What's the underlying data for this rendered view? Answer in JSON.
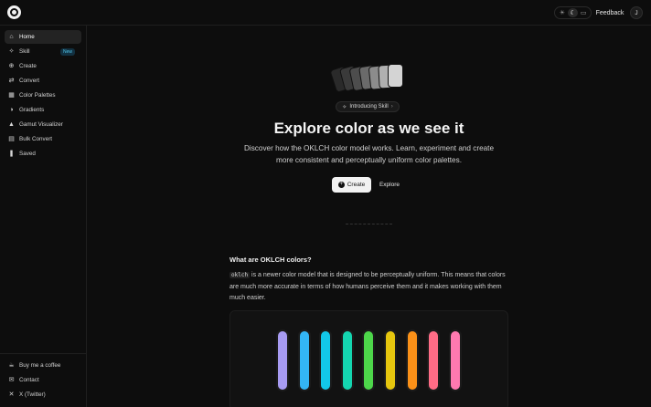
{
  "topbar": {
    "feedback_label": "Feedback",
    "avatar_initial": "J",
    "theme_options": [
      "☀",
      "☾",
      "▭"
    ]
  },
  "sidebar": {
    "items": [
      {
        "label": "Home",
        "icon": "home-icon",
        "glyph": "⌂"
      },
      {
        "label": "Skill",
        "icon": "sparkles-icon",
        "glyph": "✧",
        "badge": "New"
      },
      {
        "label": "Create",
        "icon": "plus-circle-icon",
        "glyph": "⊕"
      },
      {
        "label": "Convert",
        "icon": "swap-icon",
        "glyph": "⇄"
      },
      {
        "label": "Color Palettes",
        "icon": "palette-icon",
        "glyph": "▦"
      },
      {
        "label": "Gradients",
        "icon": "gradient-icon",
        "glyph": "◑"
      },
      {
        "label": "Gamut Visualizer",
        "icon": "gamut-icon",
        "glyph": "▲"
      },
      {
        "label": "Bulk Convert",
        "icon": "bulk-icon",
        "glyph": "▤"
      },
      {
        "label": "Saved",
        "icon": "bookmark-icon",
        "glyph": "❚"
      }
    ],
    "footer": [
      {
        "label": "Buy me a coffee",
        "icon": "coffee-icon",
        "glyph": "☕"
      },
      {
        "label": "Contact",
        "icon": "mail-icon",
        "glyph": "✉"
      },
      {
        "label": "X (Twitter)",
        "icon": "x-icon",
        "glyph": "✕"
      }
    ]
  },
  "hero": {
    "pill_label": "Introducing Skill",
    "title": "Explore color as we see it",
    "subtitle": "Discover how the OKLCH color model works. Learn, experiment and create more consistent and perceptually uniform color palettes.",
    "create_label": "Create",
    "explore_label": "Explore",
    "swatch_colors": [
      "#2a2a2a",
      "#3a3a3a",
      "#4d4d4d",
      "#6a6a6a",
      "#8c8c8c",
      "#b0b0b0",
      "#d4d4d4"
    ]
  },
  "section": {
    "title": "What are OKLCH colors?",
    "code_word": "oklch",
    "body": " is a newer color model that is designed to be perceptually uniform. This means that colors are much more accurate in terms of how humans perceive them and it makes working with them much easier."
  },
  "demo": {
    "bar_colors": [
      "#a79bf2",
      "#33b5f5",
      "#12c8ea",
      "#14d6b0",
      "#4dd64a",
      "#e6c60e",
      "#fb9118",
      "#ff6c86",
      "#ff79b0"
    ]
  }
}
